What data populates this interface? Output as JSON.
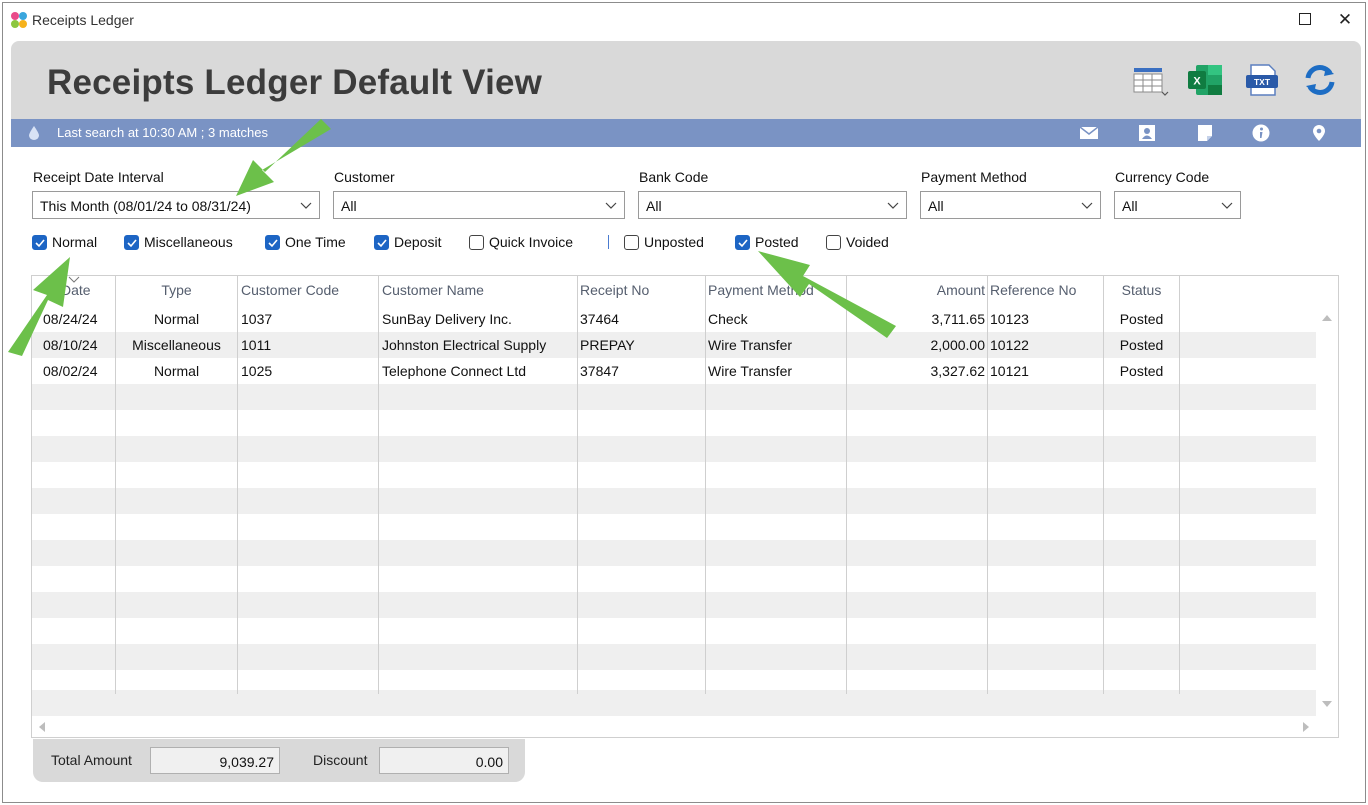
{
  "window": {
    "title": "Receipts Ledger",
    "maximize_label": "",
    "close_label": "✕"
  },
  "header": {
    "title": "Receipts Ledger Default View",
    "icons": [
      "grid-layout-icon",
      "excel-icon",
      "txt-file-icon",
      "refresh-icon"
    ]
  },
  "status": {
    "text": "Last search at 10:30 AM ; 3 matches",
    "icons": [
      "mail-icon",
      "contact-icon",
      "note-icon",
      "info-icon",
      "location-pin-icon"
    ]
  },
  "filters": {
    "receipt_date_interval": {
      "label": "Receipt Date Interval",
      "value": "This Month (08/01/24 to 08/31/24)"
    },
    "customer": {
      "label": "Customer",
      "value": "All"
    },
    "bank_code": {
      "label": "Bank Code",
      "value": "All"
    },
    "payment_method": {
      "label": "Payment Method",
      "value": "All"
    },
    "currency_code": {
      "label": "Currency Code",
      "value": "All"
    }
  },
  "checkboxes": [
    {
      "label": "Normal",
      "checked": true
    },
    {
      "label": "Miscellaneous",
      "checked": true
    },
    {
      "label": "One Time",
      "checked": true
    },
    {
      "label": "Deposit",
      "checked": true
    },
    {
      "label": "Quick Invoice",
      "checked": false
    },
    {
      "label": "Unposted",
      "checked": false
    },
    {
      "label": "Posted",
      "checked": true
    },
    {
      "label": "Voided",
      "checked": false
    }
  ],
  "table": {
    "columns": [
      "Date",
      "Type",
      "Customer Code",
      "Customer Name",
      "Receipt No",
      "Payment Method",
      "Amount",
      "Reference No",
      "Status"
    ],
    "rows": [
      [
        "08/24/24",
        "Normal",
        "1037",
        "SunBay Delivery Inc.",
        "37464",
        "Check",
        "3,711.65",
        "10123",
        "Posted"
      ],
      [
        "08/10/24",
        "Miscellaneous",
        "1011",
        "Johnston Electrical Supply",
        "PREPAY",
        "Wire Transfer",
        "2,000.00",
        "10122",
        "Posted"
      ],
      [
        "08/02/24",
        "Normal",
        "1025",
        "Telephone Connect Ltd",
        "37847",
        "Wire Transfer",
        "3,327.62",
        "10121",
        "Posted"
      ]
    ]
  },
  "totals": {
    "total_amount_label": "Total Amount",
    "total_amount": "9,039.27",
    "discount_label": "Discount",
    "discount": "0.00"
  },
  "colors": {
    "status_bar": "#7a93c4",
    "header_panel": "#d9d9d9",
    "checkbox_checked": "#1d65c4",
    "annotation_arrow": "#6cc04a"
  }
}
